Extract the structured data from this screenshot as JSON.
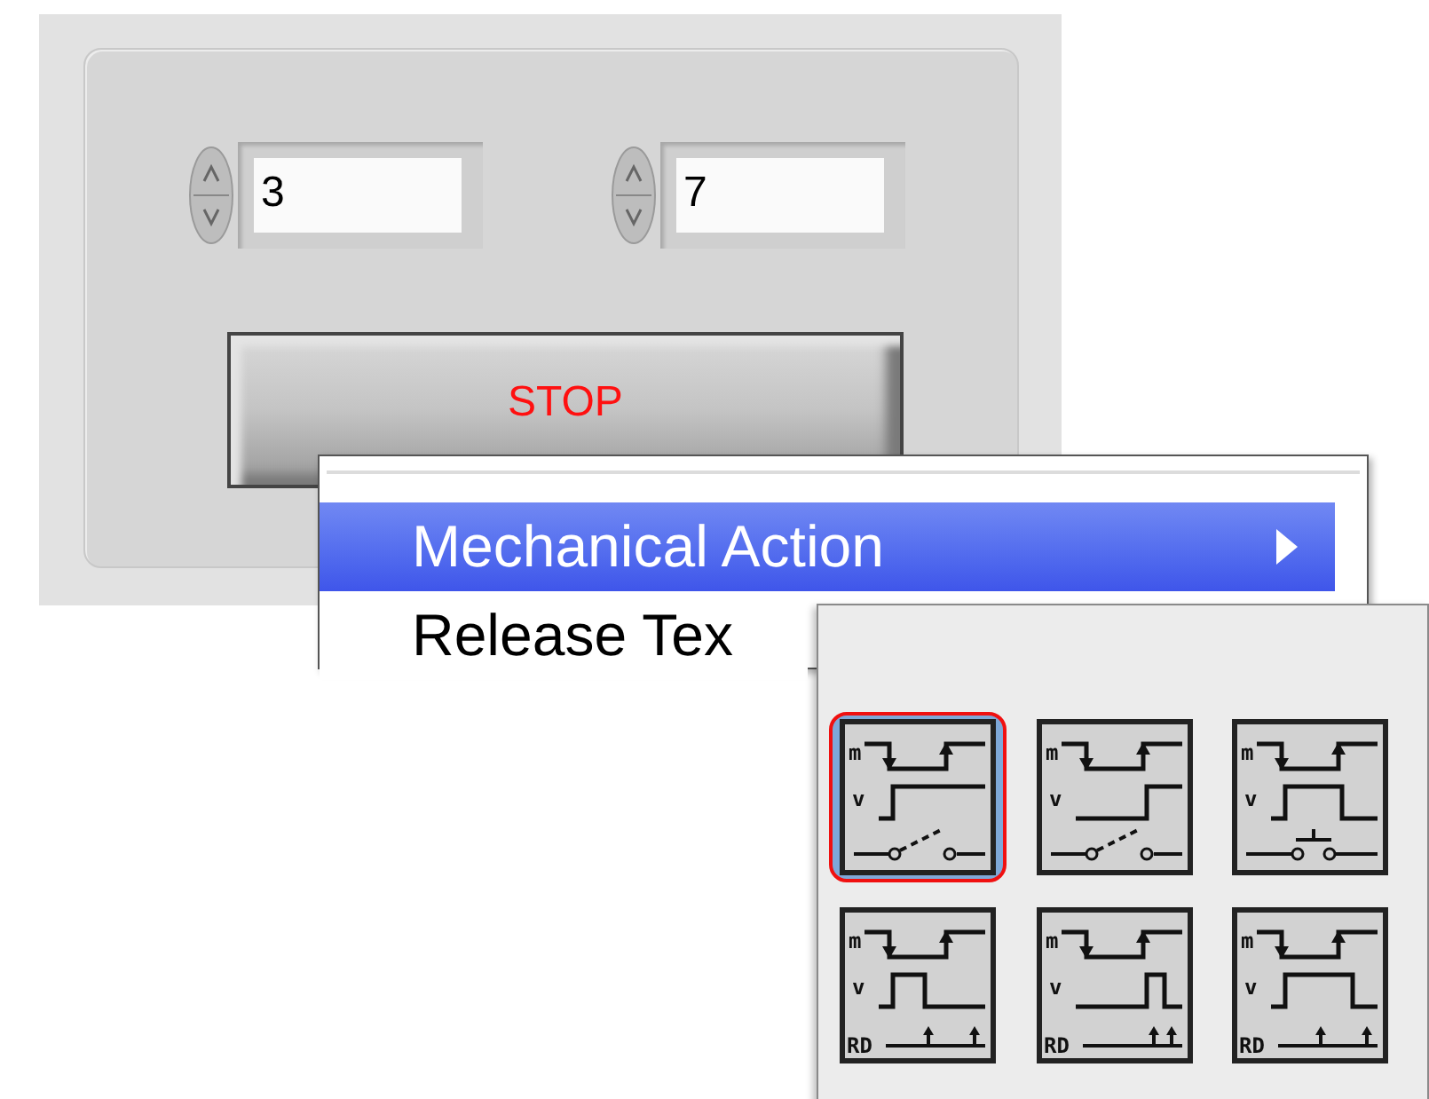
{
  "front_panel": {
    "numeric_controls": [
      {
        "value": "3"
      },
      {
        "value": "7"
      }
    ],
    "stop_button": {
      "label": "STOP"
    }
  },
  "context_menu": {
    "items": [
      {
        "label": "Mechanical Action",
        "selected": true,
        "submenu": true
      },
      {
        "label": "Release Tex",
        "selected": false,
        "submenu": false
      }
    ]
  },
  "mechanical_action_palette": {
    "options": [
      {
        "kind": "switch_when_pressed",
        "selected": true,
        "labels": [
          "m",
          "v"
        ]
      },
      {
        "kind": "switch_when_released",
        "selected": false,
        "labels": [
          "m",
          "v"
        ]
      },
      {
        "kind": "switch_until_released",
        "selected": false,
        "labels": [
          "m",
          "v"
        ]
      },
      {
        "kind": "latch_when_pressed",
        "selected": false,
        "labels": [
          "m",
          "v",
          "RD"
        ]
      },
      {
        "kind": "latch_when_released",
        "selected": false,
        "labels": [
          "m",
          "v",
          "RD"
        ]
      },
      {
        "kind": "latch_until_released",
        "selected": false,
        "labels": [
          "m",
          "v",
          "RD"
        ]
      }
    ]
  }
}
